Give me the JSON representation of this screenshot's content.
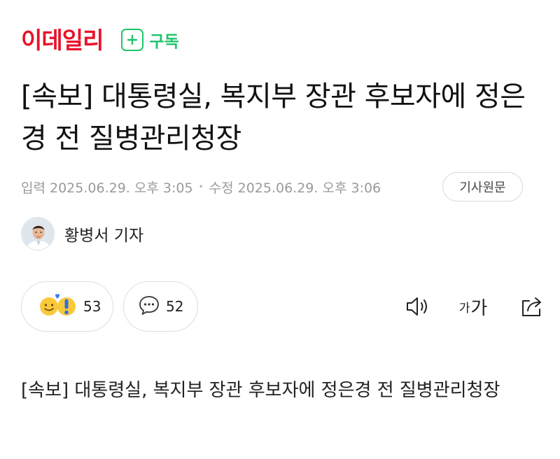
{
  "header": {
    "logo_text": "이데일리",
    "subscribe_label": "구독",
    "brand_color": "#e8132a",
    "accent_color": "#1ec46b"
  },
  "article": {
    "headline": "[속보] 대통령실, 복지부 장관 후보자에 정은경 전 질병관리청장",
    "published": "입력 2025.06.29. 오후 3:05",
    "modified": "수정 2025.06.29. 오후 3:06",
    "original_link_label": "기사원문",
    "reporter": "황병서 기자",
    "body": "[속보] 대통령실, 복지부 장관 후보자에 정은경 전 질병관리청장"
  },
  "actions": {
    "reaction_count": "53",
    "comment_count": "52",
    "font_size_label_small": "가",
    "font_size_label_large": "가"
  },
  "icons": [
    "plus-icon",
    "reaction-emoji-icon",
    "comment-bubble-icon",
    "speaker-icon",
    "font-size-icon",
    "share-icon"
  ]
}
